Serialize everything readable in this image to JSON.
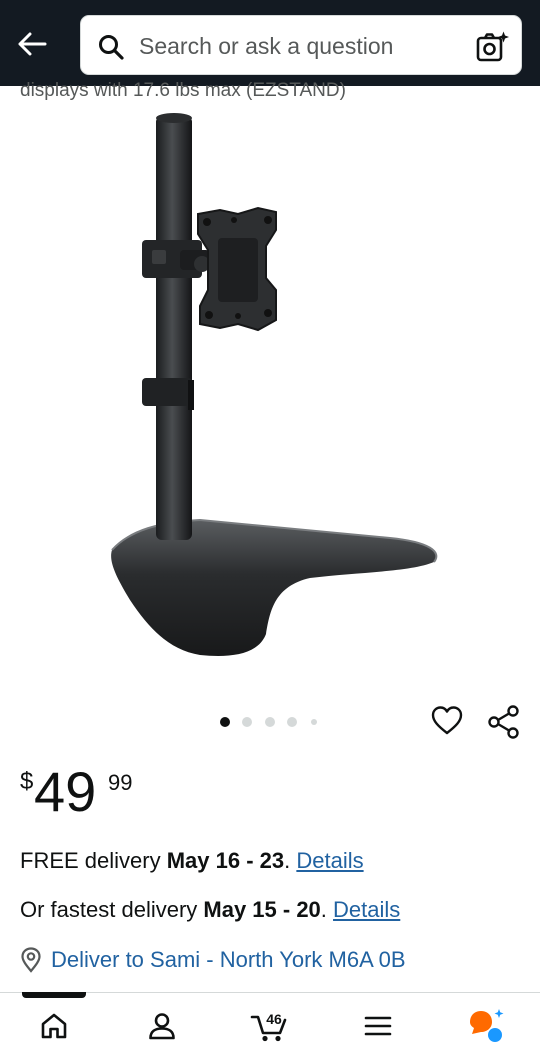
{
  "header": {
    "search_placeholder": "Search or ask a question"
  },
  "product": {
    "title_fragment": "displays with 17.6 lbs max (EZSTAND)",
    "image_count": 5,
    "image_index": 1
  },
  "price": {
    "symbol": "$",
    "whole": "49",
    "fraction": "99"
  },
  "delivery": {
    "free_prefix": "FREE delivery ",
    "free_dates": "May 16 - 23",
    "free_sep": ". ",
    "free_link": "Details",
    "fastest_prefix": "Or fastest delivery ",
    "fastest_dates": "May 15 - 20",
    "fastest_sep": ". ",
    "fastest_link": "Details",
    "deliver_to": "Deliver to Sami - North York M6A 0B"
  },
  "bottom_nav": {
    "cart_count": "46",
    "items": [
      "home-icon",
      "account-icon",
      "cart-icon",
      "menu-icon",
      "rufus-icon"
    ]
  },
  "colors": {
    "header_bg": "#131a22",
    "link": "#2162a1",
    "text": "#0f1111"
  }
}
